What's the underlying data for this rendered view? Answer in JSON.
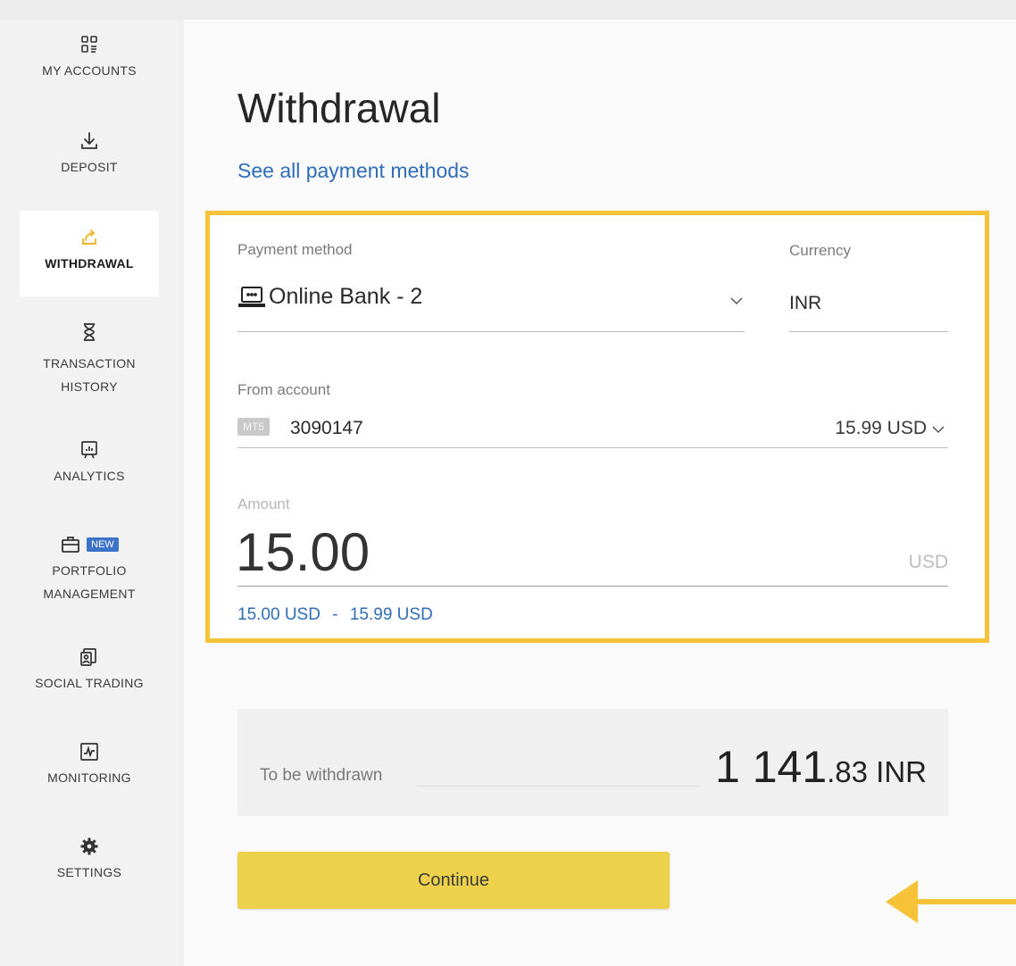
{
  "sidebar": {
    "items": [
      {
        "label": "MY ACCOUNTS",
        "icon": "accounts-grid-icon"
      },
      {
        "label": "DEPOSIT",
        "icon": "download-icon"
      },
      {
        "label": "WITHDRAWAL",
        "icon": "upload-icon",
        "active": true
      },
      {
        "label": "TRANSACTION",
        "label2": "HISTORY",
        "icon": "hourglass-icon"
      },
      {
        "label": "ANALYTICS",
        "icon": "analytics-board-icon"
      },
      {
        "label": "PORTFOLIO",
        "label2": "MANAGEMENT",
        "icon": "briefcase-icon",
        "badge": "NEW"
      },
      {
        "label": "SOCIAL TRADING",
        "icon": "social-trading-icon"
      },
      {
        "label": "MONITORING",
        "icon": "monitoring-chart-icon"
      },
      {
        "label": "SETTINGS",
        "icon": "gear-icon"
      }
    ]
  },
  "main": {
    "title": "Withdrawal",
    "see_all_link": "See all payment methods",
    "payment_method": {
      "label": "Payment method",
      "value": "Online Bank - 2",
      "icon": "laptop-icon"
    },
    "currency": {
      "label": "Currency",
      "value": "INR"
    },
    "from_account": {
      "label": "From account",
      "platform_badge": "MT5",
      "number": "3090147",
      "balance": "15.99 USD"
    },
    "amount": {
      "label": "Amount",
      "value": "15.00",
      "unit": "USD"
    },
    "range": {
      "min": "15.00 USD",
      "separator": "-",
      "max": "15.99 USD"
    },
    "summary": {
      "label": "To be withdrawn",
      "value_int": "1 141",
      "value_dec": ".83 INR"
    },
    "continue_label": "Continue"
  },
  "colors": {
    "highlight": "#f6c338",
    "link": "#2f6db8",
    "button": "#edd14a",
    "badge": "#3c73c9",
    "arrow": "#f6c338"
  }
}
